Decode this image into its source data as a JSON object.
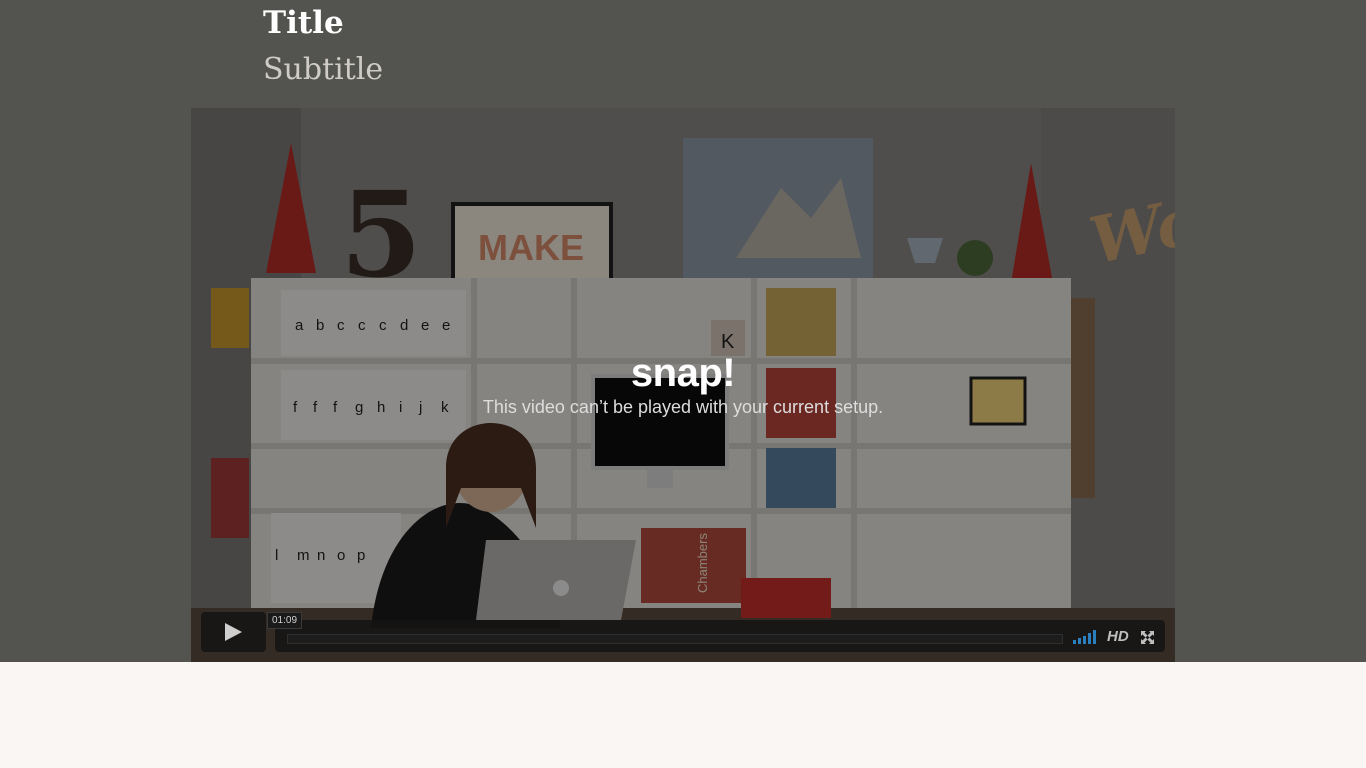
{
  "header": {
    "title": "Title",
    "subtitle": "Subtitle"
  },
  "player": {
    "error_title": "snap!",
    "error_message": "This video can’t be played with your current setup.",
    "timecode": "01:09",
    "quality_label": "HD",
    "play_icon": "play-icon",
    "volume_icon": "volume-icon",
    "fullscreen_icon": "fullscreen-icon"
  },
  "video_frame": {
    "wall_number": "5",
    "poster_text": "MAKE",
    "binder_letters_row1": [
      "a",
      "b",
      "c",
      "c",
      "c",
      "d",
      "e",
      "e"
    ],
    "binder_letters_row2": [
      "f",
      "f",
      "f",
      "g",
      "h",
      "i",
      "j",
      "k"
    ],
    "binder_letters_row3": [
      "l",
      "m",
      "n",
      "o",
      "p"
    ],
    "book_spine_text": "Chambers",
    "box_letter": "K",
    "wall_word": "Wo"
  },
  "colors": {
    "hero_background": "#53534f",
    "page_background": "#faf6f3",
    "volume_accent": "#2a7fbf"
  }
}
